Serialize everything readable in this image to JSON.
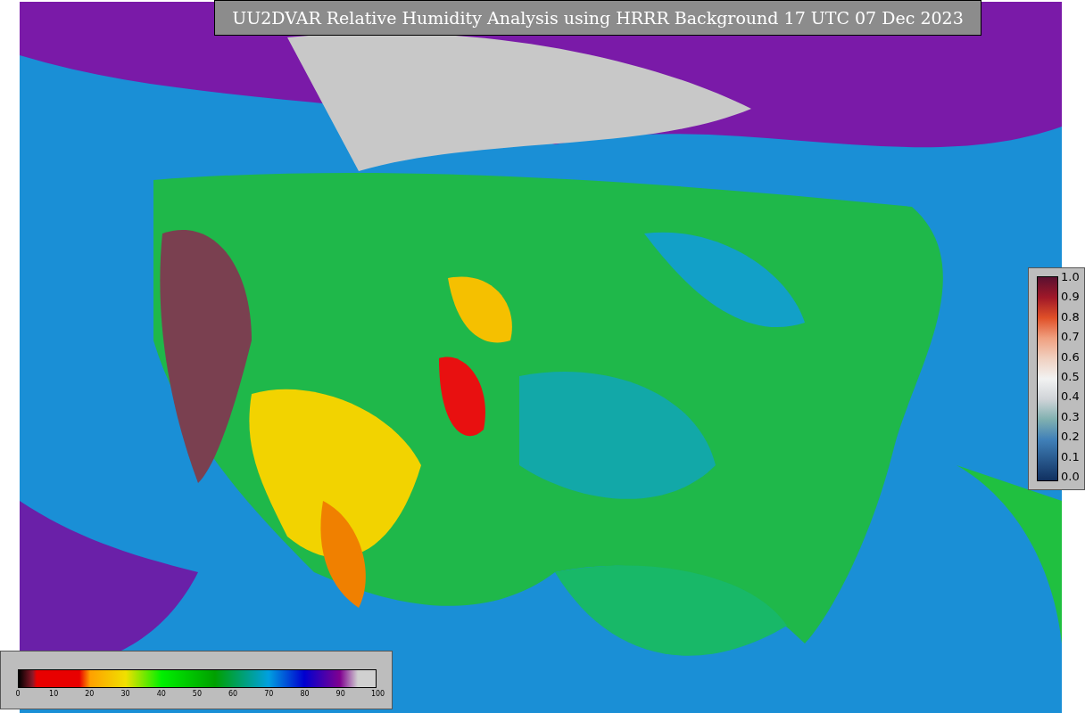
{
  "title": "UU2DVAR Relative Humidity Analysis using HRRR Background 17 UTC 07 Dec 2023",
  "side_colorbar": {
    "ticks": [
      "1.0",
      "0.9",
      "0.8",
      "0.7",
      "0.6",
      "0.5",
      "0.4",
      "0.3",
      "0.2",
      "0.1",
      "0.0"
    ]
  },
  "bottom_colorbar": {
    "ticks": [
      "0",
      "10",
      "20",
      "30",
      "40",
      "50",
      "60",
      "70",
      "80",
      "90",
      "100"
    ]
  }
}
